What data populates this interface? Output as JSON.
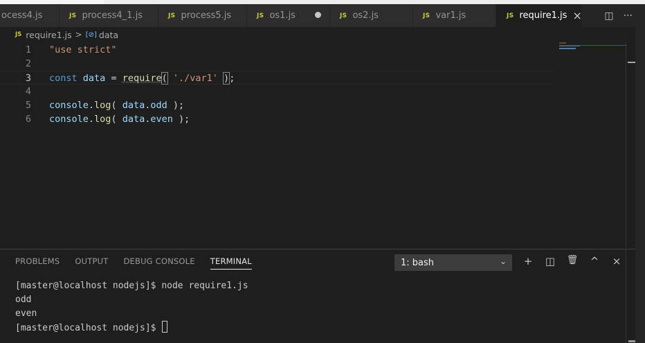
{
  "tabs": [
    {
      "label": "ocess4.js",
      "icon": "JS"
    },
    {
      "label": "process4_1.js",
      "icon": "JS"
    },
    {
      "label": "process5.js",
      "icon": "JS"
    },
    {
      "label": "os1.js",
      "icon": "JS",
      "dirty": true
    },
    {
      "label": "os2.js",
      "icon": "JS"
    },
    {
      "label": "var1.js",
      "icon": "JS"
    },
    {
      "label": "require1.js",
      "icon": "JS",
      "active": true,
      "close": "×"
    }
  ],
  "tab_actions": {
    "split_icon": "◫",
    "more_icon": "···"
  },
  "breadcrumb": {
    "icon": "JS",
    "file": "require1.js",
    "separator": ">",
    "symbol_icon": "[⊘]",
    "symbol": "data"
  },
  "editor": {
    "lines": [
      {
        "num": "1",
        "tokens": [
          {
            "t": "\"use strict\"",
            "c": "str"
          }
        ]
      },
      {
        "num": "2",
        "tokens": []
      },
      {
        "num": "3",
        "current": true,
        "tokens": [
          {
            "t": "const",
            "c": "kw"
          },
          {
            "t": " ",
            "c": "plain"
          },
          {
            "t": "data",
            "c": "var"
          },
          {
            "t": " = ",
            "c": "plain"
          },
          {
            "t": "require",
            "c": "fn"
          },
          {
            "t": "(",
            "c": "plain"
          },
          {
            "t": " ",
            "c": "plain"
          },
          {
            "t": "'./var1'",
            "c": "str"
          },
          {
            "t": " ",
            "c": "plain"
          },
          {
            "t": ")",
            "c": "plain"
          },
          {
            "t": ";",
            "c": "plain"
          }
        ]
      },
      {
        "num": "4",
        "tokens": []
      },
      {
        "num": "5",
        "tokens": [
          {
            "t": "console",
            "c": "var"
          },
          {
            "t": ".",
            "c": "plain"
          },
          {
            "t": "log",
            "c": "fn"
          },
          {
            "t": "( ",
            "c": "plain"
          },
          {
            "t": "data",
            "c": "var"
          },
          {
            "t": ".",
            "c": "plain"
          },
          {
            "t": "odd",
            "c": "var"
          },
          {
            "t": " );",
            "c": "plain"
          }
        ]
      },
      {
        "num": "6",
        "tokens": [
          {
            "t": "console",
            "c": "var"
          },
          {
            "t": ".",
            "c": "plain"
          },
          {
            "t": "log",
            "c": "fn"
          },
          {
            "t": "( ",
            "c": "plain"
          },
          {
            "t": "data",
            "c": "var"
          },
          {
            "t": ".",
            "c": "plain"
          },
          {
            "t": "even",
            "c": "var"
          },
          {
            "t": " );",
            "c": "plain"
          }
        ]
      }
    ]
  },
  "panel": {
    "tabs": [
      "PROBLEMS",
      "OUTPUT",
      "DEBUG CONSOLE",
      "TERMINAL"
    ],
    "active_tab": "TERMINAL",
    "terminal_select": "1: bash",
    "actions": {
      "add_icon": "+",
      "split_icon": "◫",
      "trash_icon": "🗑",
      "maximize_icon": "^",
      "close_icon": "×"
    },
    "terminal_lines": [
      "[master@localhost nodejs]$ node require1.js",
      "odd",
      "even",
      "[master@localhost nodejs]$ "
    ]
  },
  "colors": {
    "accent_js": "#cbcb41",
    "keyword": "#569cd6",
    "string": "#ce9178",
    "variable": "#9cdcfe",
    "function": "#dcdcaa"
  }
}
